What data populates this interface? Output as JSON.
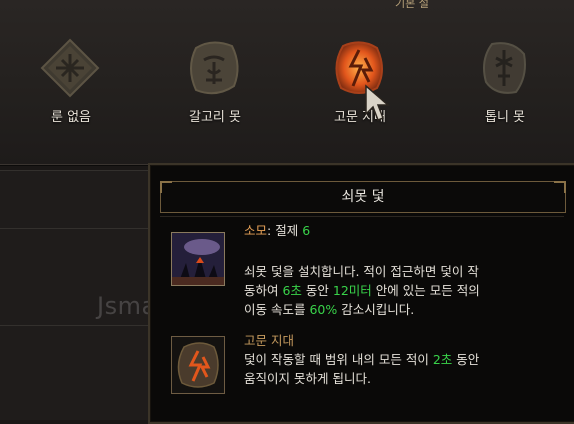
{
  "header_cut_text": "기본 설",
  "runes": [
    {
      "label": "룬 없음",
      "icon": "no-rune-icon",
      "color": "#4a4336",
      "state": "default"
    },
    {
      "label": "갈고리 못",
      "icon": "hook-spike-rune-icon",
      "color": "#4b4438",
      "state": "default"
    },
    {
      "label": "고문 지대",
      "icon": "torture-field-rune-icon",
      "color": "#e2561c",
      "state": "hovered"
    },
    {
      "label": "톱니 못",
      "icon": "sawtooth-spike-rune-icon",
      "color": "#413b33",
      "state": "default"
    }
  ],
  "tooltip": {
    "title": "쇠못 덫",
    "cost_label": "소모",
    "cost_sep": ": ",
    "cost_word": "절제 ",
    "cost_value": "6",
    "desc": {
      "l1": "쇠못 덫을 설치합니다. 적이 접근하면 덫이 작",
      "l2_a": "동하여 ",
      "l2_b": "6초",
      "l2_c": " 동안 ",
      "l2_d": "12미터",
      "l2_e": " 안에 있는 모든 적의",
      "l3_a": "이동 속도를 ",
      "l3_b": "60%",
      "l3_c": " 감소시킵니다."
    },
    "rune_name": "고문 지대",
    "rune_desc": {
      "l1_a": "덫이 작동할 때 범위 내의 모든 적이 ",
      "l1_b": "2초",
      "l1_c": " 동안",
      "l2": "움직이지 못하게 됩니다."
    }
  },
  "watermark": "Jsmall.net",
  "colors": {
    "accent_orange": "#e8a258",
    "value_green": "#39d34a",
    "gold_border": "#6d5a3b"
  }
}
